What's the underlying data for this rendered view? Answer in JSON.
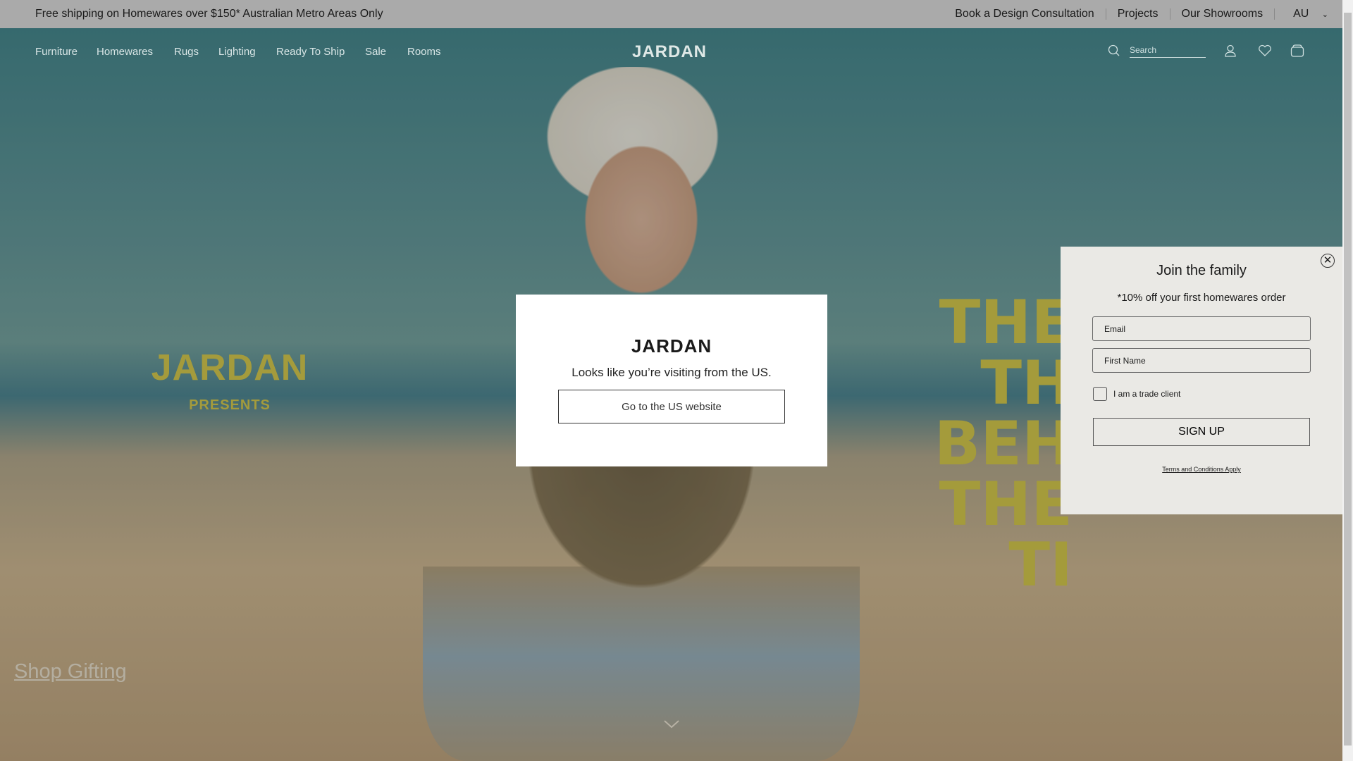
{
  "topbar": {
    "promo": "Free shipping on Homewares over $150* Australian Metro Areas Only",
    "links": [
      "Book a Design Consultation",
      "Projects",
      "Our Showrooms"
    ],
    "region": "AU"
  },
  "nav": {
    "items": [
      "Furniture",
      "Homewares",
      "Rugs",
      "Lighting",
      "Ready To Ship",
      "Sale",
      "Rooms"
    ],
    "logo": "JARDAN",
    "search_placeholder": "Search"
  },
  "hero": {
    "brand": "JARDAN",
    "presents": "PRESENTS",
    "headline": [
      "THE TH",
      "BEH",
      "THE TI"
    ],
    "cta": "Shop Gifting"
  },
  "region_modal": {
    "logo": "JARDAN",
    "message": "Looks like you’re visiting from the US.",
    "button": "Go to the US website"
  },
  "signup": {
    "title": "Join the family",
    "subtitle": "*10% off your first homewares order",
    "email_placeholder": "Email",
    "name_placeholder": "First Name",
    "trade_label": "I am a trade client",
    "button": "SIGN UP",
    "terms": "Terms and Conditions Apply"
  },
  "colors": {
    "accent_yellow": "#c9bd48",
    "popup_bg": "#eae9e5"
  }
}
